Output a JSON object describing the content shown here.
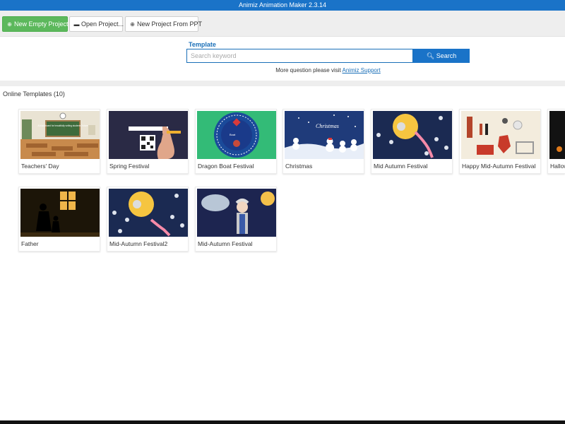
{
  "window": {
    "title": "Animiz Animation Maker 2.3.14"
  },
  "toolbar": {
    "new_empty": "New Empty Project",
    "open_project": "Open Project...",
    "new_from_ppt": "New Project From PPT"
  },
  "search": {
    "section_label": "Template",
    "placeholder": "Search keyword",
    "button_label": "Search",
    "support_text": "More question please visit",
    "support_link": "Animiz Support"
  },
  "templates": {
    "heading": "Online Templates (10)",
    "items": [
      {
        "label": "Teachers' Day",
        "thumb_icon": "classroom-thumbnail",
        "thumb_text": "A blackboard for beautifully writing students' future"
      },
      {
        "label": "Spring Festival",
        "thumb_icon": "qr-code-thumbnail"
      },
      {
        "label": "Dragon Boat Festival",
        "thumb_icon": "dragon-boat-badge-thumbnail",
        "thumb_text": "Boat"
      },
      {
        "label": "Christmas",
        "thumb_icon": "snowmen-thumbnail",
        "thumb_text": "Christmas"
      },
      {
        "label": "Mid Autumn Festival",
        "thumb_icon": "moon-rabbit-thumbnail"
      },
      {
        "label": "Happy Mid-Autumn Festival",
        "thumb_icon": "london-thumbnail"
      },
      {
        "label": "Hallow",
        "thumb_icon": "halloween-thumbnail"
      },
      {
        "label": "Father",
        "thumb_icon": "father-silhouette-thumbnail"
      },
      {
        "label": "Mid-Autumn Festival2",
        "thumb_icon": "moon-rabbit-thumbnail"
      },
      {
        "label": "Mid-Autumn Festival",
        "thumb_icon": "grandma-moon-thumbnail"
      }
    ]
  },
  "colors": {
    "titlebar": "#1a73c8",
    "primary": "#1a73c8",
    "success": "#5cb85c",
    "link": "#1a6fb8"
  }
}
